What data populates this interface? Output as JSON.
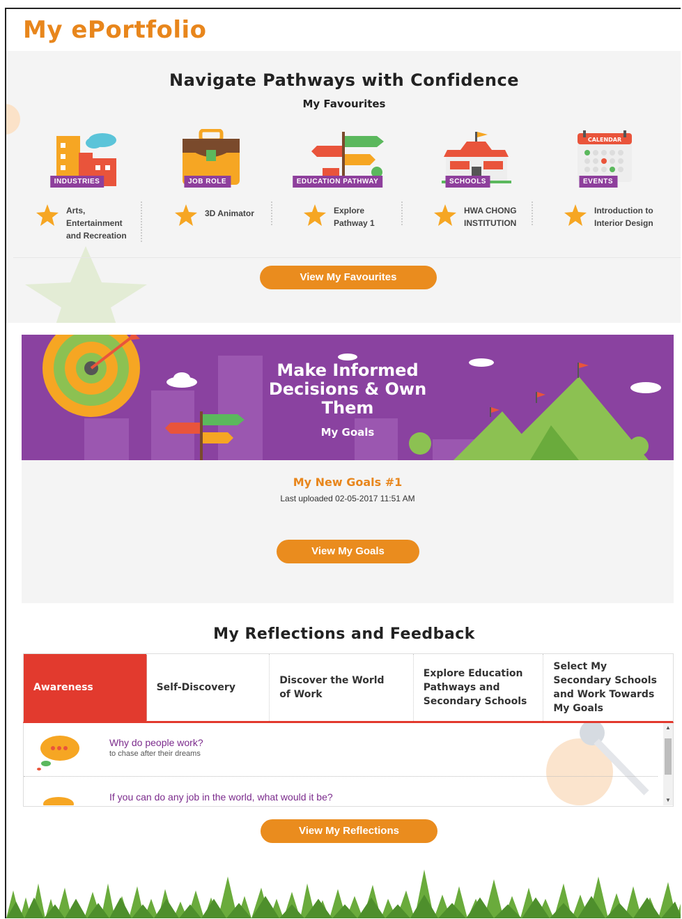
{
  "app": {
    "title": "My ePortfolio"
  },
  "favourites": {
    "heading": "Navigate Pathways with Confidence",
    "subheading": "My Favourites",
    "categories": [
      {
        "label": "INDUSTRIES",
        "icon": "buildings-icon",
        "item": "Arts, Entertainment and Recreation"
      },
      {
        "label": "JOB ROLE",
        "icon": "briefcase-icon",
        "item": "3D Animator"
      },
      {
        "label": "EDUCATION PATHWAY",
        "icon": "signpost-icon",
        "item": "Explore Pathway 1"
      },
      {
        "label": "SCHOOLS",
        "icon": "school-icon",
        "item": "HWA CHONG INSTITUTION"
      },
      {
        "label": "EVENTS",
        "icon": "calendar-icon",
        "calendar_text": "CALENDAR",
        "item": "Introduction to Interior Design"
      }
    ],
    "button": "View My Favourites"
  },
  "goals": {
    "banner_title": "Make Informed Decisions & Own Them",
    "banner_subtitle": "My Goals",
    "goal_title": "My New Goals #1",
    "last_uploaded": "Last uploaded 02-05-2017 11:51 AM",
    "button": "View My Goals"
  },
  "reflections": {
    "heading": "My Reflections and Feedback",
    "tabs": [
      {
        "label": "Awareness",
        "active": true
      },
      {
        "label": "Self-Discovery",
        "active": false
      },
      {
        "label": "Discover the World of Work",
        "active": false
      },
      {
        "label": "Explore Education Pathways and Secondary Schools",
        "active": false
      },
      {
        "label": "Select My Secondary Schools and Work Towards My Goals",
        "active": false
      }
    ],
    "items": [
      {
        "question": "Why do people work?",
        "answer": "to chase after their dreams"
      },
      {
        "question": "If you can do any job in the world, what would it be?",
        "answer": ""
      }
    ],
    "button": "View My Reflections"
  },
  "colors": {
    "accent": "#ea8c1e",
    "purple": "#8a42a0",
    "active_tab": "#e23a2e",
    "star": "#f6a623"
  }
}
